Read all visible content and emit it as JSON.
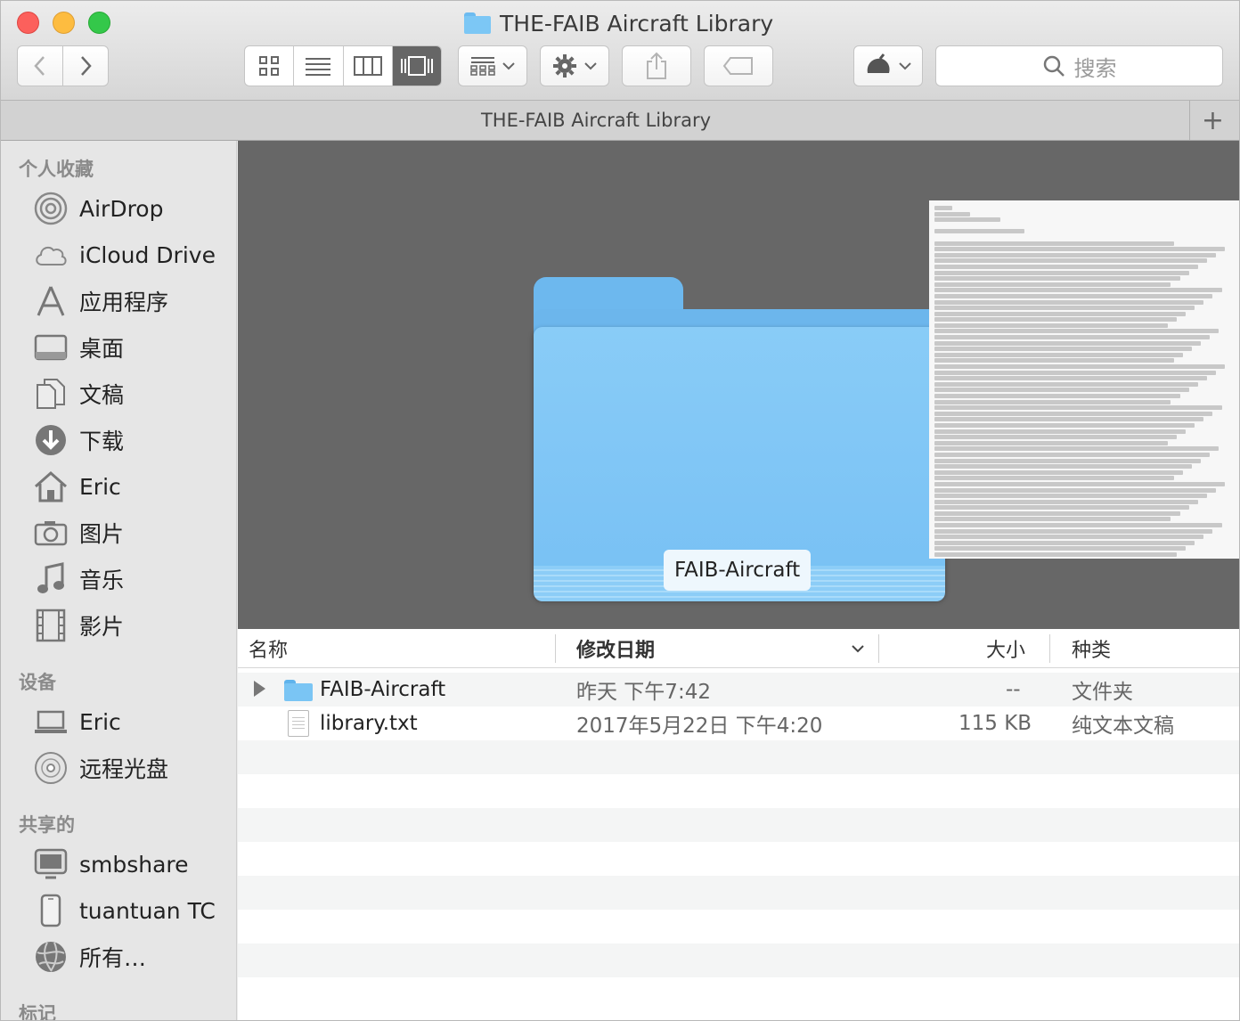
{
  "window": {
    "title": "THE-FAIB Aircraft Library",
    "tab_title": "THE-FAIB Aircraft Library",
    "tab_add": "+"
  },
  "toolbar": {
    "back_icon": "chevron-left-icon",
    "forward_icon": "chevron-right-icon",
    "view_modes": [
      "icon-view",
      "list-view",
      "column-view",
      "gallery-view"
    ],
    "active_view": "gallery-view",
    "search_placeholder": "搜索"
  },
  "sidebar": {
    "sections": [
      {
        "heading": "个人收藏",
        "items": [
          {
            "label": "AirDrop",
            "icon": "airdrop-icon"
          },
          {
            "label": "iCloud Drive",
            "icon": "cloud-icon"
          },
          {
            "label": "应用程序",
            "icon": "applications-icon"
          },
          {
            "label": "桌面",
            "icon": "desktop-icon"
          },
          {
            "label": "文稿",
            "icon": "documents-icon"
          },
          {
            "label": "下载",
            "icon": "download-icon"
          },
          {
            "label": "Eric",
            "icon": "home-icon"
          },
          {
            "label": "图片",
            "icon": "camera-icon"
          },
          {
            "label": "音乐",
            "icon": "music-note-icon"
          },
          {
            "label": "影片",
            "icon": "film-icon"
          }
        ]
      },
      {
        "heading": "设备",
        "items": [
          {
            "label": "Eric",
            "icon": "laptop-icon"
          },
          {
            "label": "远程光盘",
            "icon": "disc-icon"
          }
        ]
      },
      {
        "heading": "共享的",
        "items": [
          {
            "label": "smbshare",
            "icon": "monitor-icon"
          },
          {
            "label": "tuantuan TC",
            "icon": "time-capsule-icon"
          },
          {
            "label": "所有…",
            "icon": "network-globe-icon"
          }
        ]
      },
      {
        "heading": "标记",
        "items": []
      }
    ]
  },
  "gallery": {
    "selected_label": "FAIB-Aircraft"
  },
  "list": {
    "columns": {
      "name": "名称",
      "modified": "修改日期",
      "size": "大小",
      "kind": "种类"
    },
    "rows": [
      {
        "name": "FAIB-Aircraft",
        "modified": "昨天 下午7:42",
        "size": "--",
        "kind": "文件夹",
        "icon": "folder-icon"
      },
      {
        "name": "library.txt",
        "modified": "2017年5月22日 下午4:20",
        "size": "115 KB",
        "kind": "纯文本文稿",
        "icon": "text-document-icon"
      }
    ]
  }
}
